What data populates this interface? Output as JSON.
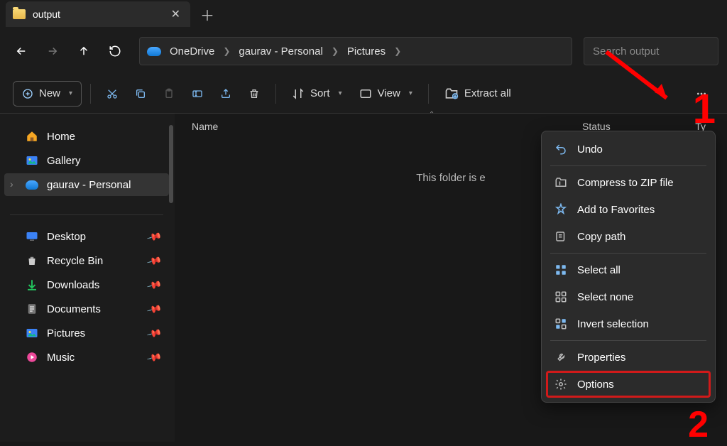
{
  "tab": {
    "title": "output"
  },
  "nav": {
    "breadcrumb": [
      "OneDrive",
      "gaurav - Personal",
      "Pictures"
    ],
    "search_placeholder": "Search output"
  },
  "toolbar": {
    "new_label": "New",
    "sort_label": "Sort",
    "view_label": "View",
    "extract_label": "Extract all"
  },
  "sidebar": {
    "top": [
      {
        "label": "Home",
        "icon": "home"
      },
      {
        "label": "Gallery",
        "icon": "gallery"
      },
      {
        "label": "gaurav - Personal",
        "icon": "onedrive",
        "selected": true
      }
    ],
    "pinned": [
      {
        "label": "Desktop",
        "icon": "desktop"
      },
      {
        "label": "Recycle Bin",
        "icon": "recycle"
      },
      {
        "label": "Downloads",
        "icon": "downloads"
      },
      {
        "label": "Documents",
        "icon": "documents"
      },
      {
        "label": "Pictures",
        "icon": "pictures"
      },
      {
        "label": "Music",
        "icon": "music"
      }
    ]
  },
  "columns": {
    "name": "Name",
    "status": "Status",
    "type": "Ty"
  },
  "empty_text": "This folder is e",
  "menu": {
    "items": [
      {
        "label": "Undo",
        "icon": "undo"
      },
      "sep",
      {
        "label": "Compress to ZIP file",
        "icon": "zip"
      },
      {
        "label": "Add to Favorites",
        "icon": "pin"
      },
      {
        "label": "Copy path",
        "icon": "copypath"
      },
      "sep",
      {
        "label": "Select all",
        "icon": "selectall"
      },
      {
        "label": "Select none",
        "icon": "selectnone"
      },
      {
        "label": "Invert selection",
        "icon": "invert"
      },
      "sep",
      {
        "label": "Properties",
        "icon": "wrench"
      },
      {
        "label": "Options",
        "icon": "gear",
        "highlighted": true
      }
    ]
  },
  "annotations": {
    "one": "1",
    "two": "2"
  }
}
